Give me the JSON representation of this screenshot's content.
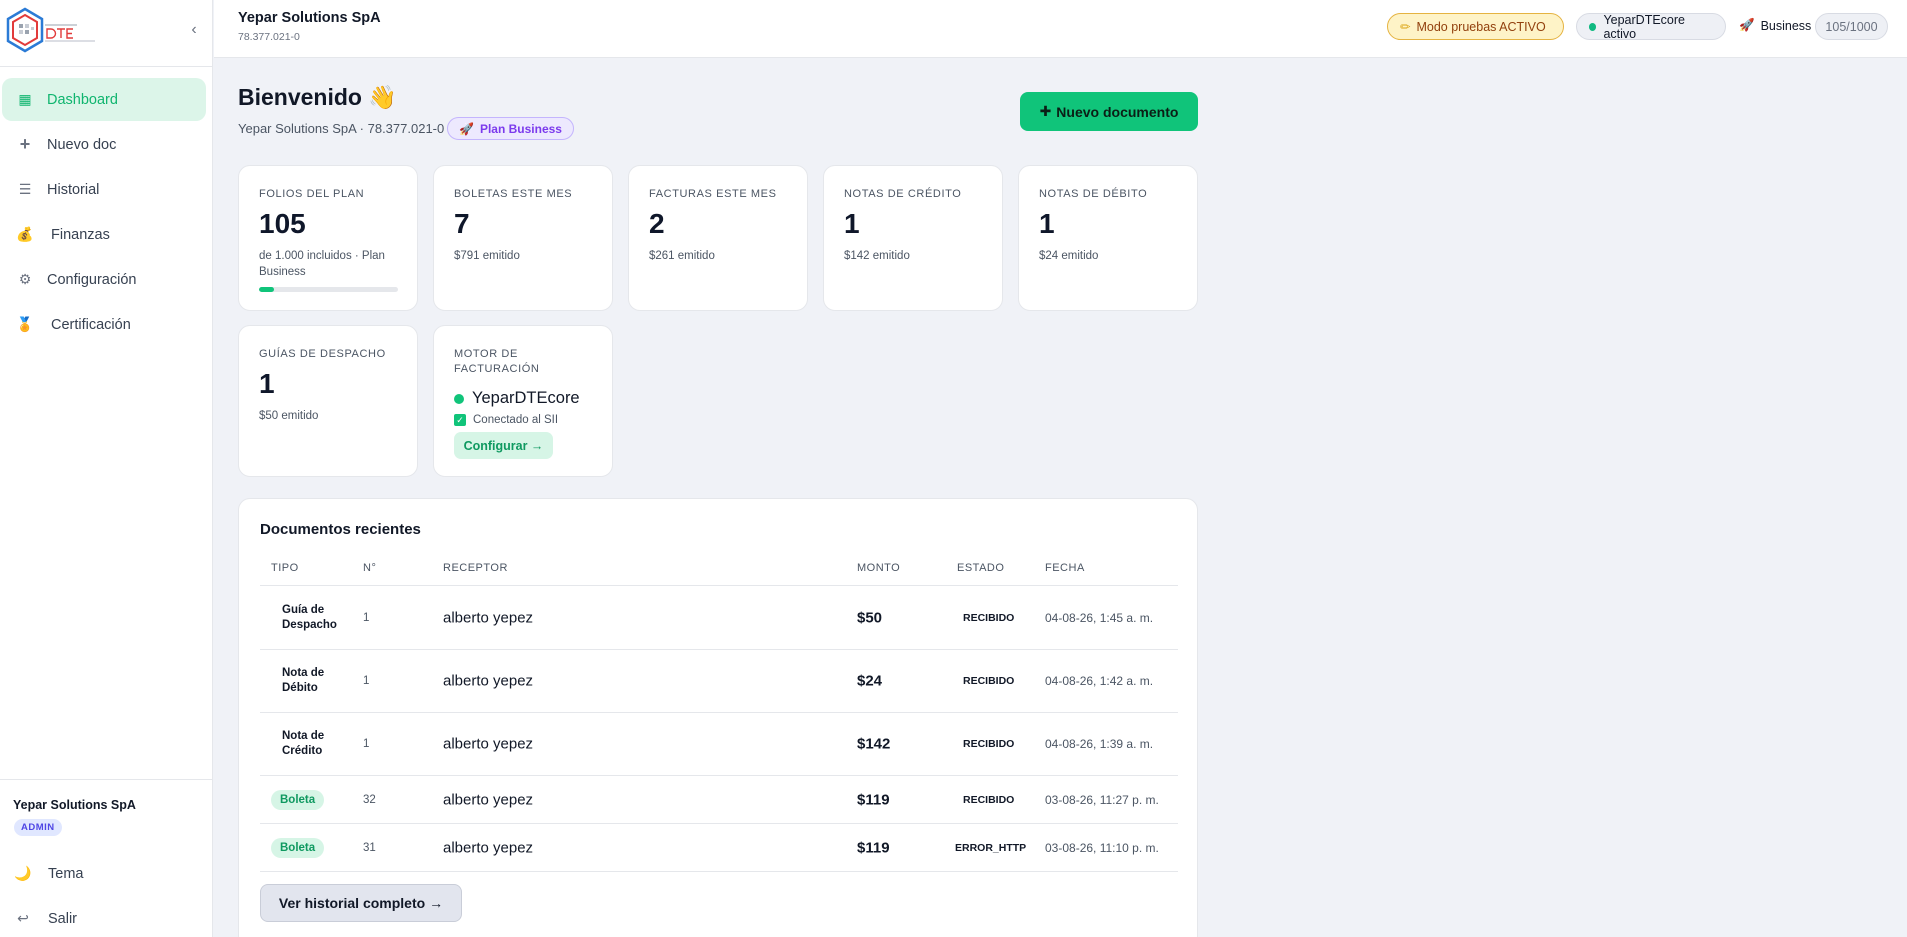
{
  "sidebar": {
    "items": [
      {
        "label": "Dashboard",
        "icon": "grid-icon",
        "active": true
      },
      {
        "label": "Nuevo doc",
        "icon": "plus-icon"
      },
      {
        "label": "Historial",
        "icon": "list-icon"
      },
      {
        "label": "Finanzas",
        "icon": "money-bag-icon"
      },
      {
        "label": "Configuración",
        "icon": "gear-icon"
      },
      {
        "label": "Certificación",
        "icon": "medal-icon"
      }
    ],
    "org_name": "Yepar Solutions SpA",
    "role": "ADMIN",
    "theme_label": "Tema",
    "logout_label": "Salir"
  },
  "topbar": {
    "company": "Yepar Solutions SpA",
    "rut": "78.377.021-0",
    "test_mode": "Modo pruebas ACTIVO",
    "engine_status": "YeparDTEcore activo",
    "plan": "Business",
    "usage": "105/1000"
  },
  "main": {
    "greeting": "Bienvenido",
    "wave": "👋",
    "sub_line": "Yepar Solutions SpA · 78.377.021-0",
    "plan_badge": "Plan Business",
    "new_doc_button": "Nuevo documento"
  },
  "cards": {
    "folios": {
      "label": "Folios del plan",
      "value": "105",
      "note": "de 1.000 incluidos · Plan Business",
      "progress": 0.105
    },
    "boletas": {
      "label": "Boletas este mes",
      "value": "7",
      "note": "$791 emitido"
    },
    "facturas": {
      "label": "Facturas este mes",
      "value": "2",
      "note": "$261 emitido"
    },
    "credito": {
      "label": "Notas de crédito",
      "value": "1",
      "note": "$142 emitido"
    },
    "debito": {
      "label": "Notas de débito",
      "value": "1",
      "note": "$24 emitido"
    },
    "guias": {
      "label": "Guías de despacho",
      "value": "1",
      "note": "$50 emitido"
    },
    "motor": {
      "label": "Motor de facturación",
      "engine": "YeparDTEcore",
      "connected": "Conectado al SII",
      "button": "Configurar →"
    }
  },
  "recent": {
    "title": "Documentos recientes",
    "headers": {
      "type": "TIPO",
      "num": "N°",
      "receptor": "RECEPTOR",
      "amount": "MONTO",
      "status": "ESTADO",
      "date": "FECHA"
    },
    "rows": [
      {
        "type": "Guía de Despacho",
        "num": "1",
        "receptor": "alberto yepez",
        "amount": "$50",
        "status": "RECIBIDO",
        "date": "04-08-26, 1:45 a. m."
      },
      {
        "type": "Nota de Débito",
        "num": "1",
        "receptor": "alberto yepez",
        "amount": "$24",
        "status": "RECIBIDO",
        "date": "04-08-26, 1:42 a. m."
      },
      {
        "type": "Nota de Crédito",
        "num": "1",
        "receptor": "alberto yepez",
        "amount": "$142",
        "status": "RECIBIDO",
        "date": "04-08-26, 1:39 a. m."
      },
      {
        "type": "Boleta",
        "num": "32",
        "receptor": "alberto yepez",
        "amount": "$119",
        "status": "RECIBIDO",
        "date": "03-08-26, 11:27 p. m."
      },
      {
        "type": "Boleta",
        "num": "31",
        "receptor": "alberto yepez",
        "amount": "$119",
        "status": "ERROR_HTTP",
        "date": "03-08-26, 11:10 p. m."
      }
    ],
    "history_button": "Ver historial completo →"
  },
  "colors": {
    "accent": "#10c47a",
    "accent_bg": "#dcf5e9",
    "plan_purple": "#7c3aed",
    "warning_bg": "#fef3c7"
  }
}
